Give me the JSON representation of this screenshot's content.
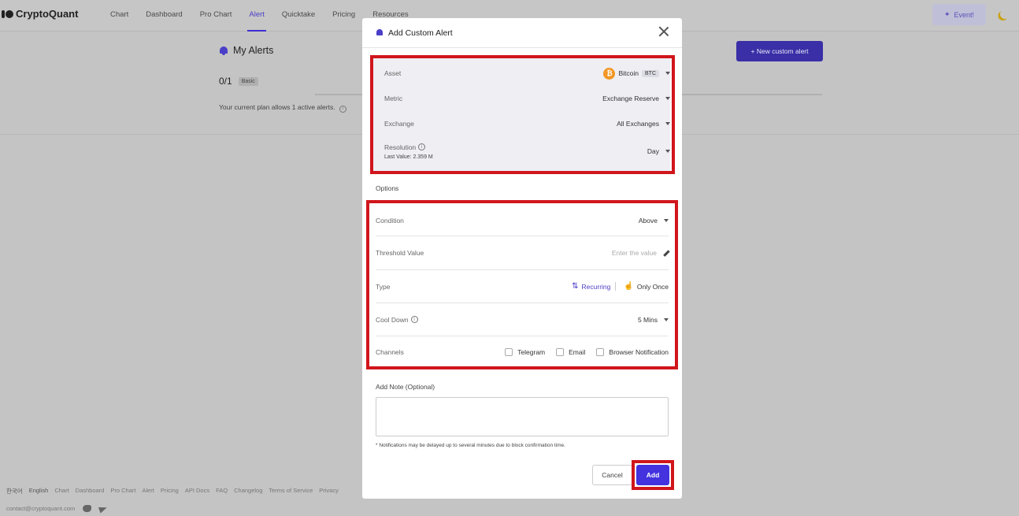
{
  "app": {
    "logo_text": "CryptoQuant"
  },
  "nav": {
    "items": [
      {
        "label": "Chart"
      },
      {
        "label": "Dashboard"
      },
      {
        "label": "Pro Chart"
      },
      {
        "label": "Alert",
        "active": true
      },
      {
        "label": "Quicktake"
      },
      {
        "label": "Pricing"
      },
      {
        "label": "Resources"
      }
    ],
    "event_label": "Event!",
    "accent_color": "#3d2fcf"
  },
  "alerts_page": {
    "title": "My Alerts",
    "count": "0/1",
    "plan_badge": "Basic",
    "plan_text": "Your current plan allows 1 active alerts.",
    "new_alert_label": "+ New custom alert"
  },
  "footer": {
    "lang_ko": "한국어",
    "lang_en": "English",
    "links": [
      "Chart",
      "Dashboard",
      "Pro Chart",
      "Alert",
      "Pricing",
      "API Docs",
      "FAQ",
      "Changelog",
      "Terms of Service",
      "Privacy"
    ],
    "email": "contact@cryptoquant.com"
  },
  "modal": {
    "title": "Add Custom Alert",
    "asset": {
      "label": "Asset",
      "value": "Bitcoin",
      "ticker": "BTC",
      "coin_symbol": "₿"
    },
    "metric": {
      "label": "Metric",
      "value": "Exchange Reserve"
    },
    "exchange": {
      "label": "Exchange",
      "value": "All Exchanges"
    },
    "resolution": {
      "label": "Resolution",
      "value": "Day",
      "last_value": "Last Value: 2.359 M"
    },
    "options_label": "Options",
    "condition": {
      "label": "Condition",
      "value": "Above"
    },
    "threshold": {
      "label": "Threshold Value",
      "placeholder": "Enter the value"
    },
    "type": {
      "label": "Type",
      "recurring": "Recurring",
      "once": "Only Once"
    },
    "cooldown": {
      "label": "Cool Down",
      "value": "5 Mins"
    },
    "channels": {
      "label": "Channels",
      "telegram": "Telegram",
      "email": "Email",
      "browser": "Browser Notification"
    },
    "note_label": "Add Note (Optional)",
    "footnote": "* Notifications may be delayed up to several minutes due to block confirmation time.",
    "cancel_label": "Cancel",
    "add_label": "Add",
    "highlight_color": "#d0161c",
    "add_color": "#4332de"
  }
}
